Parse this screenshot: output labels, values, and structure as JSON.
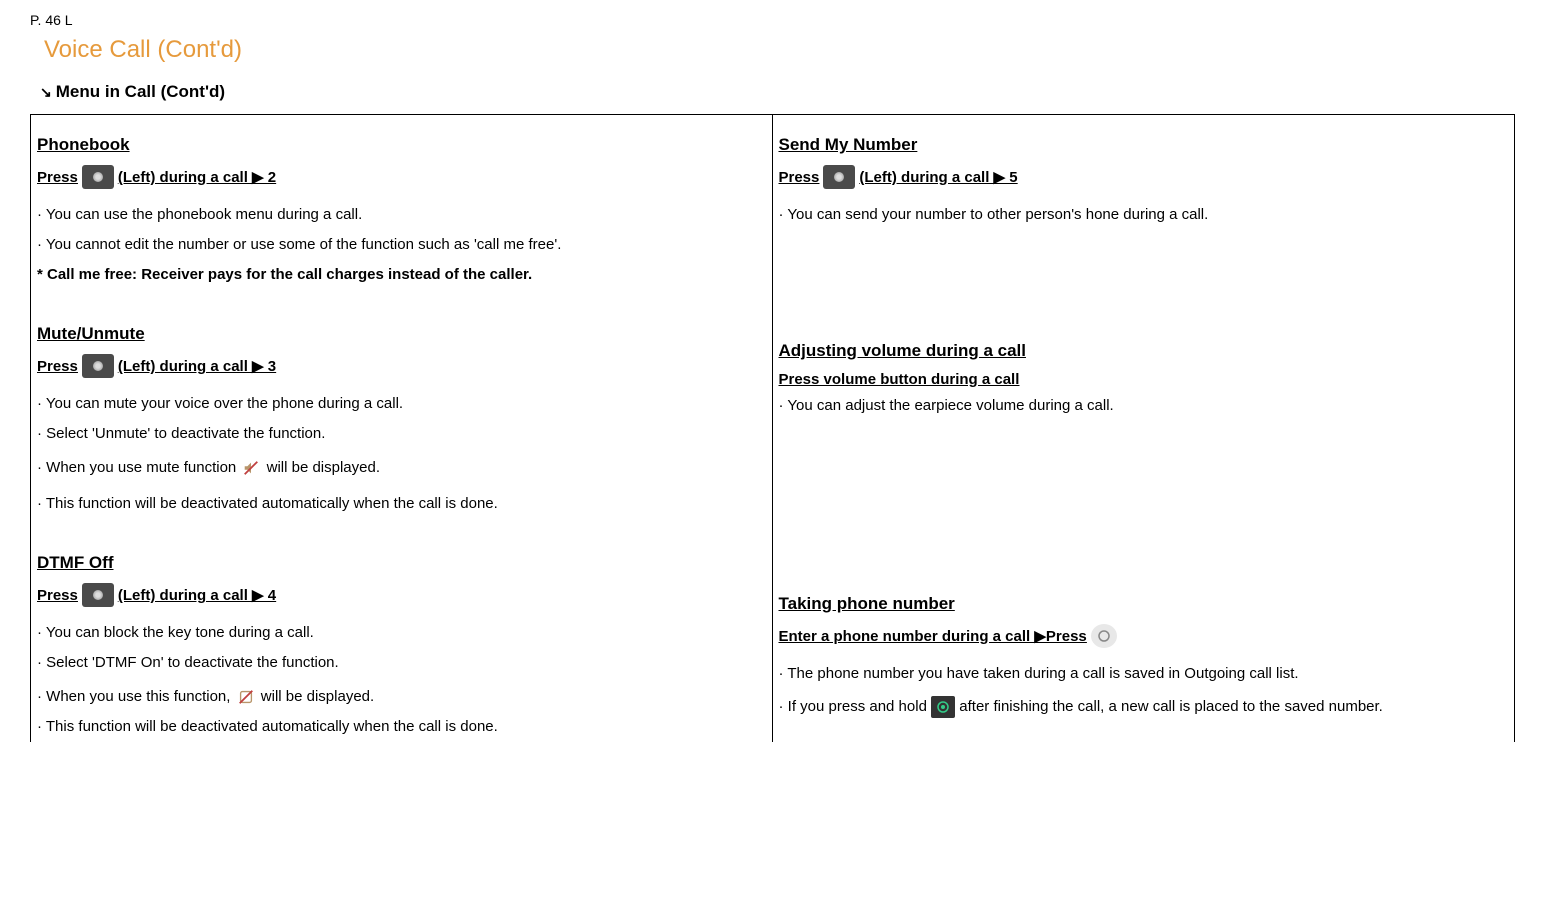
{
  "page_header": "P. 46    L",
  "section_title": "Voice Call (Cont'd)",
  "subsection_title": "Menu in Call (Cont'd)",
  "left": {
    "phonebook": {
      "title": "Phonebook",
      "press_prefix": "Press ",
      "press_suffix": " (Left) during a call ▶ 2",
      "lines": [
        "· You can use the phonebook menu during a call.",
        "· You cannot edit the number or use some of the function such as 'call me free'.",
        "* Call me free: Receiver pays for the call charges instead of the caller."
      ]
    },
    "mute": {
      "title": "Mute/Unmute",
      "press_prefix": "Press ",
      "press_suffix": " (Left) during a call ▶ 3",
      "lines": [
        "· You can mute your voice over the phone during a call.",
        "· Select 'Unmute' to deactivate the function."
      ],
      "line_icon_prefix": "· When you use mute function ",
      "line_icon_suffix": "  will be displayed.",
      "line_last": "· This function will be deactivated automatically when the call is done."
    },
    "dtmf": {
      "title": "DTMF Off",
      "press_prefix": "Press ",
      "press_suffix": " (Left) during a call ▶ 4",
      "lines": [
        "· You can block the key tone during a call.",
        "· Select 'DTMF On' to deactivate the function."
      ],
      "line_icon_prefix": "· When you use this function,  ",
      "line_icon_suffix": "  will be displayed.",
      "line_last": "· This function will be deactivated automatically when the call is done."
    }
  },
  "right": {
    "sendnum": {
      "title": "Send My Number",
      "press_prefix": "Press ",
      "press_suffix": " (Left) during a call ▶ 5",
      "lines": [
        "· You can send your number to other person's hone during a call."
      ]
    },
    "volume": {
      "title": "Adjusting volume during a call  ",
      "press": "Press volume button during a call",
      "lines": [
        "· You can adjust the earpiece volume during a call."
      ]
    },
    "taking": {
      "title": "Taking phone number  ",
      "press_prefix": "Enter a phone number during a call    ▶Press ",
      "lines": [
        "· The phone number you have taken during a call is saved in Outgoing call list."
      ],
      "line_icon_prefix": "· If you press and hold ",
      "line_icon_suffix": " after finishing the call, a new call is placed to the saved number."
    }
  }
}
